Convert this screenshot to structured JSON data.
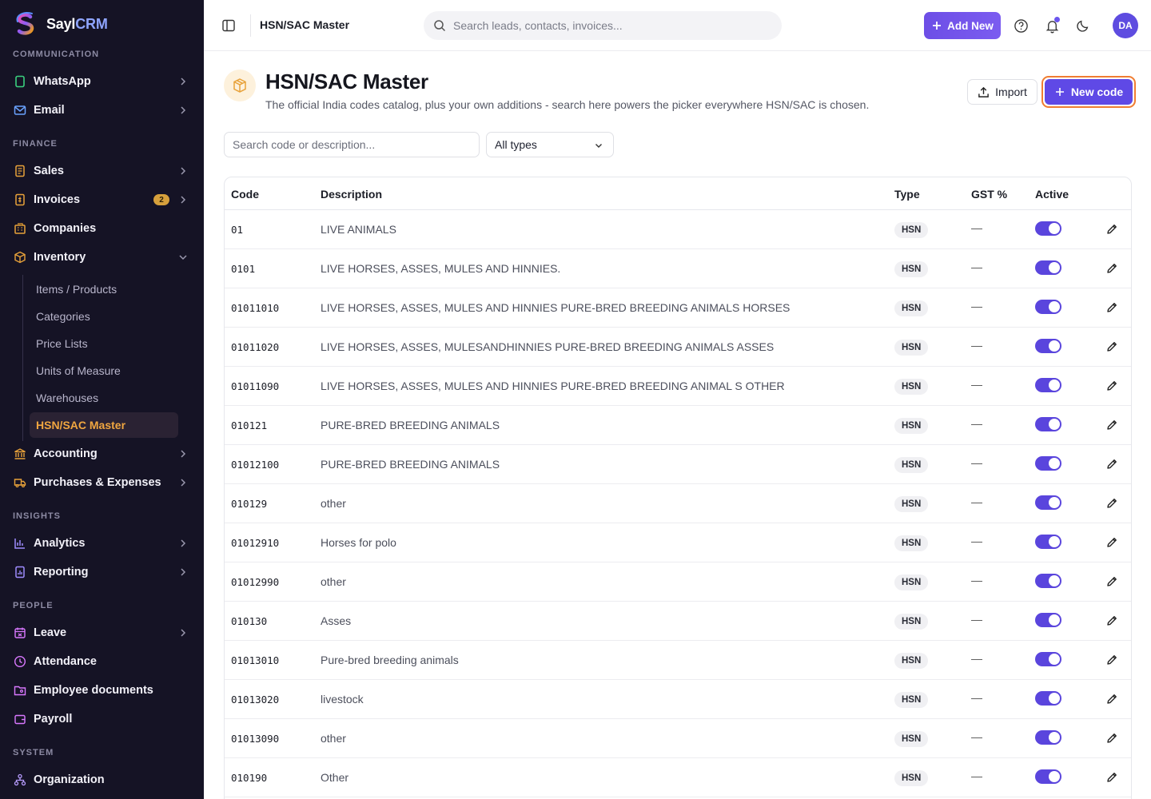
{
  "brand": {
    "name_a": "Sayl",
    "name_b": "CRM"
  },
  "sidebar": {
    "sections": {
      "communication": "COMMUNICATION",
      "finance": "FINANCE",
      "insights": "INSIGHTS",
      "people": "PEOPLE",
      "system": "SYSTEM"
    },
    "items": {
      "whatsapp": "WhatsApp",
      "email": "Email",
      "sales": "Sales",
      "invoices": "Invoices",
      "invoices_badge": "2",
      "companies": "Companies",
      "inventory": "Inventory",
      "accounting": "Accounting",
      "purchases": "Purchases & Expenses",
      "analytics": "Analytics",
      "reporting": "Reporting",
      "leave": "Leave",
      "attendance": "Attendance",
      "employee_documents": "Employee documents",
      "payroll": "Payroll",
      "organization": "Organization"
    },
    "inventory_sub": {
      "items_products": "Items / Products",
      "categories": "Categories",
      "price_lists": "Price Lists",
      "units": "Units of Measure",
      "warehouses": "Warehouses",
      "hsn_sac": "HSN/SAC Master"
    }
  },
  "topbar": {
    "title": "HSN/SAC Master",
    "search_placeholder": "Search leads, contacts, invoices...",
    "add_new": "Add New",
    "avatar": "DA"
  },
  "page": {
    "title": "HSN/SAC Master",
    "subtitle": "The official India codes catalog, plus your own additions - search here powers the picker everywhere HSN/SAC is chosen.",
    "import_label": "Import",
    "new_code_label": "New code",
    "search_placeholder": "Search code or description...",
    "type_filter": "All types"
  },
  "table": {
    "columns": {
      "code": "Code",
      "description": "Description",
      "type": "Type",
      "gst": "GST %",
      "active": "Active"
    },
    "rows": [
      {
        "code": "01",
        "description": "LIVE ANIMALS",
        "type": "HSN",
        "gst": "—",
        "active": true
      },
      {
        "code": "0101",
        "description": "LIVE HORSES, ASSES, MULES AND HINNIES.",
        "type": "HSN",
        "gst": "—",
        "active": true
      },
      {
        "code": "01011010",
        "description": "LIVE HORSES, ASSES, MULES AND HINNIES PURE-BRED BREEDING ANIMALS HORSES",
        "type": "HSN",
        "gst": "—",
        "active": true
      },
      {
        "code": "01011020",
        "description": "LIVE HORSES, ASSES, MULESANDHINNIES PURE-BRED BREEDING ANIMALS ASSES",
        "type": "HSN",
        "gst": "—",
        "active": true
      },
      {
        "code": "01011090",
        "description": "LIVE HORSES, ASSES, MULES AND HINNIES PURE-BRED BREEDING ANIMAL S OTHER",
        "type": "HSN",
        "gst": "—",
        "active": true
      },
      {
        "code": "010121",
        "description": "PURE-BRED BREEDING ANIMALS",
        "type": "HSN",
        "gst": "—",
        "active": true
      },
      {
        "code": "01012100",
        "description": "PURE-BRED BREEDING ANIMALS",
        "type": "HSN",
        "gst": "—",
        "active": true
      },
      {
        "code": "010129",
        "description": "other",
        "type": "HSN",
        "gst": "—",
        "active": true
      },
      {
        "code": "01012910",
        "description": "Horses for polo",
        "type": "HSN",
        "gst": "—",
        "active": true
      },
      {
        "code": "01012990",
        "description": "other",
        "type": "HSN",
        "gst": "—",
        "active": true
      },
      {
        "code": "010130",
        "description": "Asses",
        "type": "HSN",
        "gst": "—",
        "active": true
      },
      {
        "code": "01013010",
        "description": "Pure-bred breeding animals",
        "type": "HSN",
        "gst": "—",
        "active": true
      },
      {
        "code": "01013020",
        "description": "livestock",
        "type": "HSN",
        "gst": "—",
        "active": true
      },
      {
        "code": "01013090",
        "description": "other",
        "type": "HSN",
        "gst": "—",
        "active": true
      },
      {
        "code": "010190",
        "description": "Other",
        "type": "HSN",
        "gst": "—",
        "active": true
      }
    ]
  },
  "colors": {
    "sidebar_bg": "#151325",
    "accent": "#5f49e6",
    "active_sub": "#f0a640",
    "focus_ring": "#f07d32",
    "badge": "#d6a03c"
  },
  "icons": [
    "whatsapp-icon",
    "mail-icon",
    "receipt-icon",
    "invoice-icon",
    "building-icon",
    "box-icon",
    "bank-icon",
    "truck-icon",
    "bar-chart-icon",
    "report-icon",
    "calendar-x-icon",
    "clock-icon",
    "folder-user-icon",
    "wallet-icon",
    "org-icon",
    "sidebar-toggle-icon",
    "search-icon",
    "plus-icon",
    "help-icon",
    "bell-icon",
    "moon-icon",
    "upload-icon",
    "chevron-down-icon",
    "pencil-icon"
  ]
}
